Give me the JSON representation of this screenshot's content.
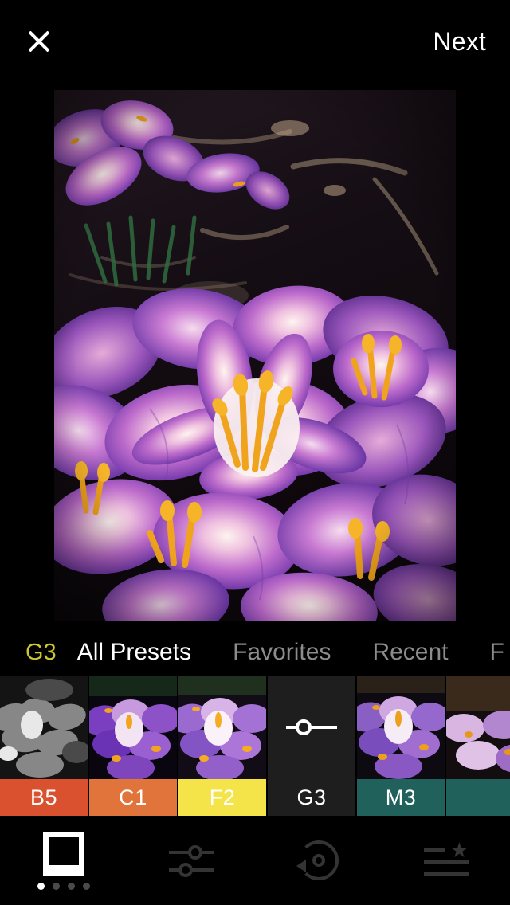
{
  "app": {
    "background": "#000000"
  },
  "topbar": {
    "close_icon": "close-icon",
    "next_label": "Next"
  },
  "photo": {
    "alt": "purple crocus flowers in bloom on dark soil",
    "subject": "crocus flowers",
    "palette": {
      "petal_light": "#e9b9dc",
      "petal_mid": "#b469c4",
      "petal_deep": "#5b2ea0",
      "stamen": "#f5a623",
      "soil": "#1a1014",
      "twig": "#c6b194"
    }
  },
  "tabs": [
    {
      "label": "G3",
      "kind": "code",
      "active": false,
      "color": "#cbc730"
    },
    {
      "label": "All Presets",
      "kind": "active",
      "active": true,
      "color": "#ffffff"
    },
    {
      "label": "Favorites",
      "kind": "inactive",
      "active": false,
      "color": "#8c8c8c"
    },
    {
      "label": "Recent",
      "kind": "inactive",
      "active": false,
      "color": "#8c8c8c"
    },
    {
      "label": "F",
      "kind": "cut",
      "active": false,
      "color": "#8c8c8c"
    }
  ],
  "presets": [
    {
      "name": "B5",
      "label_color": "#d9512f",
      "style": "bw",
      "selected": false
    },
    {
      "name": "C1",
      "label_color": "#e0743a",
      "style": "violet",
      "selected": false
    },
    {
      "name": "F2",
      "label_color": "#f5e34a",
      "style": "bright",
      "selected": false
    },
    {
      "name": "G3",
      "label_color": "#1e1e1e",
      "style": "slider",
      "selected": true
    },
    {
      "name": "M3",
      "label_color": "#20615c",
      "style": "teal",
      "selected": false
    },
    {
      "name": "",
      "label_color": "#20615c",
      "style": "warm",
      "selected": false
    }
  ],
  "bottomnav": [
    {
      "icon": "filters-polaroid-icon",
      "active": true,
      "dots": 4,
      "active_dot": 1
    },
    {
      "icon": "adjustments-sliders-icon",
      "active": false
    },
    {
      "icon": "history-undo-icon",
      "active": false
    },
    {
      "icon": "presets-list-star-icon",
      "active": false
    }
  ]
}
